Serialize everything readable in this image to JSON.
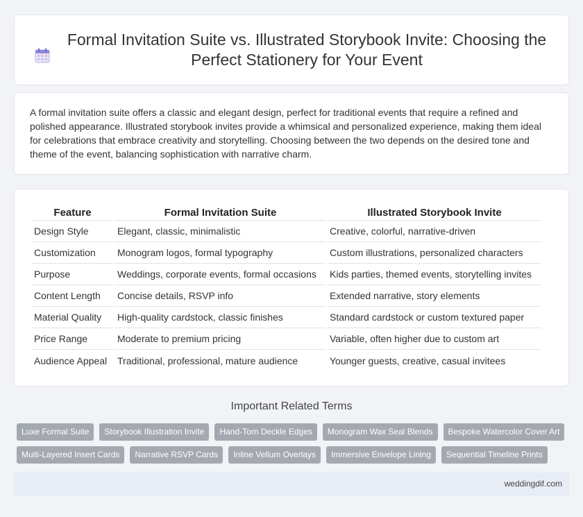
{
  "header": {
    "title": "Formal Invitation Suite vs. Illustrated Storybook Invite: Choosing the Perfect Stationery for Your Event",
    "icon": "calendar-icon"
  },
  "intro": {
    "text": "A formal invitation suite offers a classic and elegant design, perfect for traditional events that require a refined and polished appearance. Illustrated storybook invites provide a whimsical and personalized experience, making them ideal for celebrations that embrace creativity and storytelling. Choosing between the two depends on the desired tone and theme of the event, balancing sophistication with narrative charm."
  },
  "comparison": {
    "headers": [
      "Feature",
      "Formal Invitation Suite",
      "Illustrated Storybook Invite"
    ],
    "rows": [
      [
        "Design Style",
        "Elegant, classic, minimalistic",
        "Creative, colorful, narrative-driven"
      ],
      [
        "Customization",
        "Monogram logos, formal typography",
        "Custom illustrations, personalized characters"
      ],
      [
        "Purpose",
        "Weddings, corporate events, formal occasions",
        "Kids parties, themed events, storytelling invites"
      ],
      [
        "Content Length",
        "Concise details, RSVP info",
        "Extended narrative, story elements"
      ],
      [
        "Material Quality",
        "High-quality cardstock, classic finishes",
        "Standard cardstock or custom textured paper"
      ],
      [
        "Price Range",
        "Moderate to premium pricing",
        "Variable, often higher due to custom art"
      ],
      [
        "Audience Appeal",
        "Traditional, professional, mature audience",
        "Younger guests, creative, casual invitees"
      ]
    ]
  },
  "related": {
    "title": "Important Related Terms",
    "tags": [
      "Luxe Formal Suite",
      "Storybook Illustration Invite",
      "Hand-Torn Deckle Edges",
      "Monogram Wax Seal Blends",
      "Bespoke Watercolor Cover Art",
      "Multi-Layered Insert Cards",
      "Narrative RSVP Cards",
      "Inline Vellum Overlays",
      "Immersive Envelope Lining",
      "Sequential Timeline Prints"
    ]
  },
  "footer": {
    "site": "weddingdif.com"
  },
  "colors": {
    "tag_bg": "#a4a9b1",
    "footer_bg": "#e7ecf5",
    "page_bg": "#f1f3f7"
  }
}
